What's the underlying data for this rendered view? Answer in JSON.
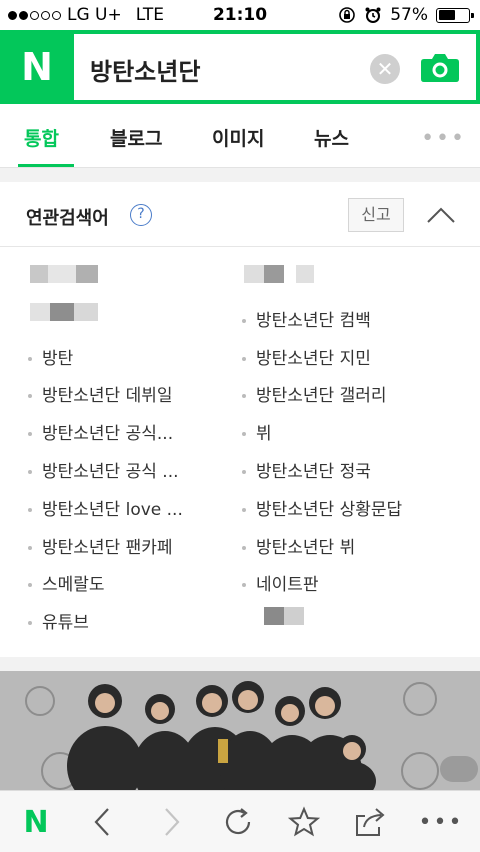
{
  "status_bar": {
    "carrier": "LG U+",
    "network": "LTE",
    "time": "21:10",
    "battery": "57%",
    "battery_level": 0.57
  },
  "search": {
    "logo": "N",
    "query": "방탄소년단"
  },
  "tabs": [
    "통합",
    "블로그",
    "이미지",
    "뉴스"
  ],
  "related": {
    "title": "연관검색어",
    "report_label": "신고",
    "left": [
      "방탄",
      "방탄소년단 데뷔일",
      "방탄소년단 공식...",
      "방탄소년단 공식 ...",
      "방탄소년단 love ...",
      "방탄소년단 팬카페",
      "스메랄도",
      "유튜브"
    ],
    "right": [
      "방탄소년단 컴백",
      "방탄소년단 지민",
      "방탄소년단 갤러리",
      "뷔",
      "방탄소년단 정국",
      "방탄소년단 상황문답",
      "방탄소년단 뷔",
      "네이트판"
    ]
  },
  "colors": {
    "brand": "#03c75a"
  },
  "icons": [
    "camera-icon",
    "clear-icon",
    "help-icon",
    "chevron-up-icon",
    "back-icon",
    "forward-icon",
    "refresh-icon",
    "star-icon",
    "share-icon",
    "more-icon"
  ]
}
